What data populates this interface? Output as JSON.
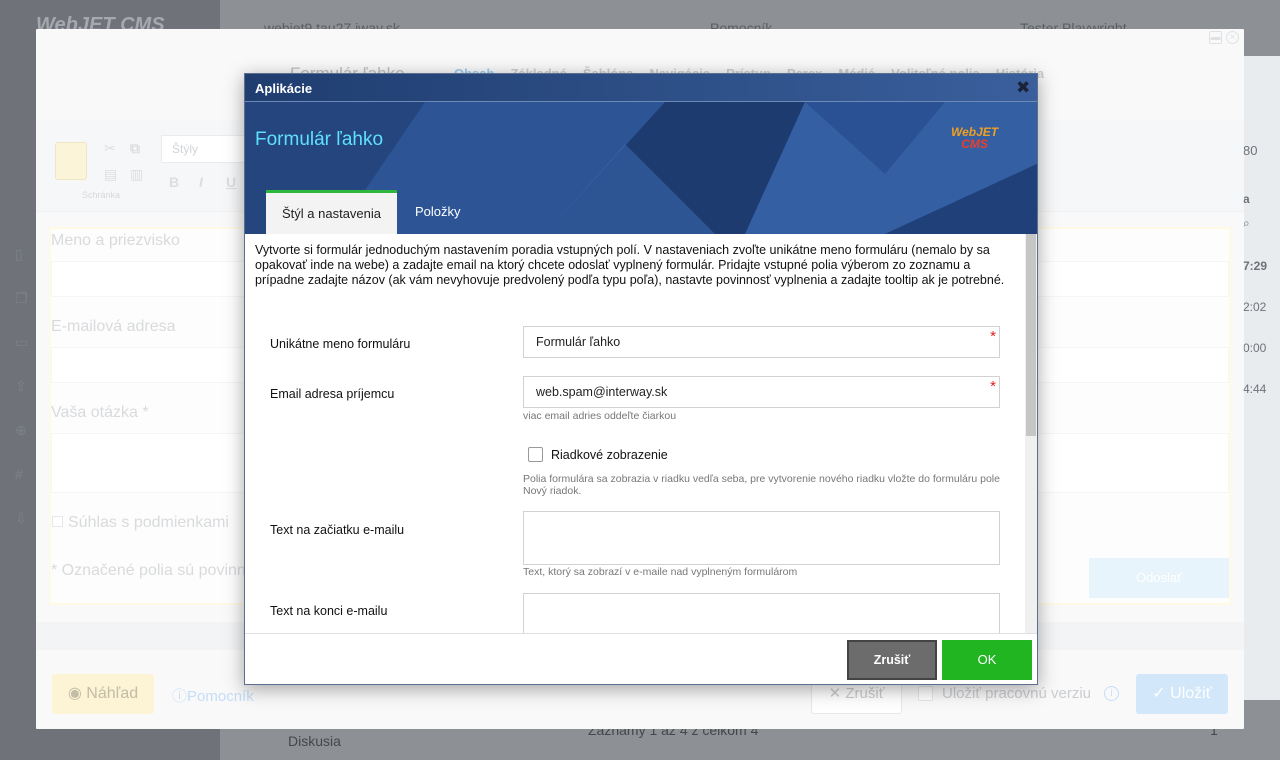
{
  "background": {
    "logo": "WebJET CMS",
    "topbar": {
      "domain": "webjet9.tau27.iway.sk",
      "help": "Pomocník",
      "user": "Tester Playwright"
    },
    "bottom_folder": "Diskusia",
    "bottom_records": "Záznamy 1 až 4 z celkom 4",
    "pager": "1",
    "right_column": [
      "80",
      "a",
      "7:29",
      "2:02",
      "0:00",
      "4:44"
    ]
  },
  "editor": {
    "title": "Formulár ľahko",
    "tabs": [
      "Obsah",
      "Základné",
      "Šablóna",
      "Navigácia",
      "Prístup",
      "Perex",
      "Médiá",
      "Voliteľné polia",
      "História"
    ],
    "toolbar": {
      "styles_placeholder": "Štýly",
      "clipboard_label": "Schránka",
      "bold": "B",
      "italic": "I",
      "underline": "U"
    },
    "form": {
      "name_label": "Meno a priezvisko",
      "email_label": "E-mailová adresa",
      "question_label": "Vaša otázka *",
      "consent_label": "Súhlas s podmienkami",
      "required_note": "* Označené polia sú povinné",
      "send_button": "Odoslať"
    },
    "footer": {
      "preview": "Náhľad",
      "help": "Pomocník",
      "cancel": "Zrušiť",
      "save_version": "Uložiť pracovnú verziu",
      "save": "Uložiť"
    }
  },
  "dialog": {
    "titlebar": "Aplikácie",
    "app_title": "Formulár ľahko",
    "logo_line1": "WebJET",
    "logo_line2": "CMS",
    "tabs": {
      "style": "Štýl a nastavenia",
      "items": "Položky"
    },
    "intro": "Vytvorte si formulár jednoduchým nastavením poradia vstupných polí. V nastaveniach zvoľte unikátne meno formuláru (nemalo by sa opakovať inde na webe) a zadajte email na ktorý chcete odoslať vyplnený formulár. Pridajte vstupné polia výberom zo zoznamu a prípadne zadajte názov (ak vám nevyhovuje predvolený podľa typu poľa), nastavte povinnosť vyplnenia a zadajte tooltip ak je potrebné.",
    "fields": {
      "form_name_label": "Unikátne meno formuláru",
      "form_name_value": "Formulár ľahko",
      "email_label": "Email adresa príjemcu",
      "email_value": "web.spam@interway.sk",
      "email_help": "viac email adries oddeľte čiarkou",
      "inline_label": "Riadkové zobrazenie",
      "inline_help": "Polia formulára sa zobrazia v riadku vedľa seba, pre vytvorenie nového riadku vložte do formuláru pole Nový riadok.",
      "text_before_label": "Text na začiatku e-mailu",
      "text_before_help": "Text, ktorý sa zobrazí v e-maile nad vyplneným formulárom",
      "text_after_label": "Text na konci e-mailu",
      "required_mark": "*"
    },
    "buttons": {
      "cancel": "Zrušiť",
      "ok": "OK"
    }
  },
  "colors": {
    "accent_green": "#21b521",
    "accent_cyan": "#5ee0ff",
    "required_red": "#e02020"
  }
}
